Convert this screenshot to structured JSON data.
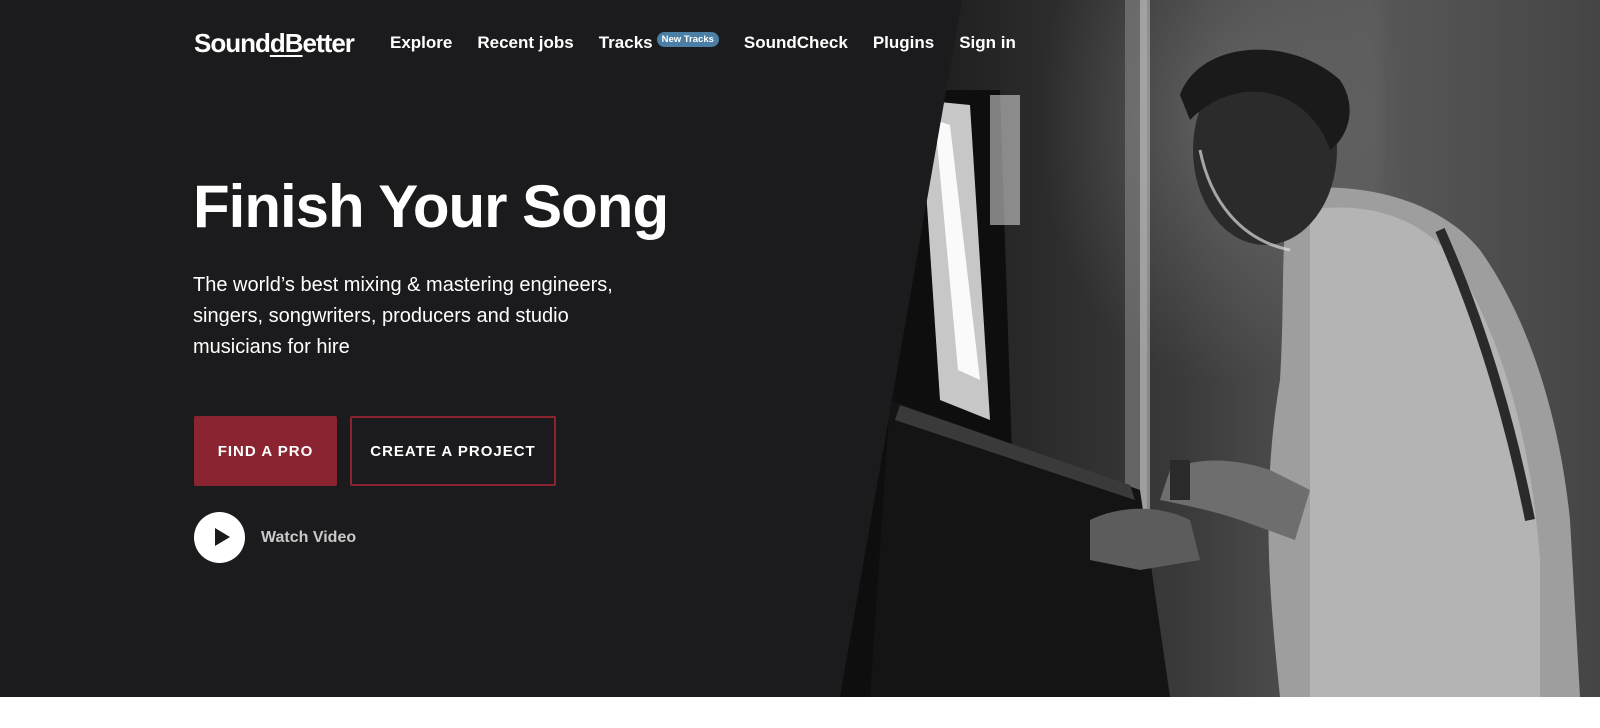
{
  "brand": {
    "name_start": "Sound",
    "name_mid": "B",
    "name_end": "etter",
    "name_d": "d"
  },
  "nav": {
    "items": [
      {
        "label": "Explore"
      },
      {
        "label": "Recent jobs"
      },
      {
        "label": "Tracks",
        "badge": "New Tracks"
      },
      {
        "label": "SoundCheck"
      },
      {
        "label": "Plugins"
      },
      {
        "label": "Sign in"
      }
    ]
  },
  "hero": {
    "title": "Finish Your Song",
    "subtitle": "The world’s best mixing & mastering engineers, singers, songwriters, producers and studio musicians for hire",
    "primary_button": "FIND A PRO",
    "secondary_button": "CREATE A PROJECT",
    "video_label": "Watch Video"
  },
  "colors": {
    "background": "#1b1a1c",
    "accent": "#8b2431",
    "badge": "#4b7fa5"
  },
  "icons": {
    "video": "play-icon"
  }
}
